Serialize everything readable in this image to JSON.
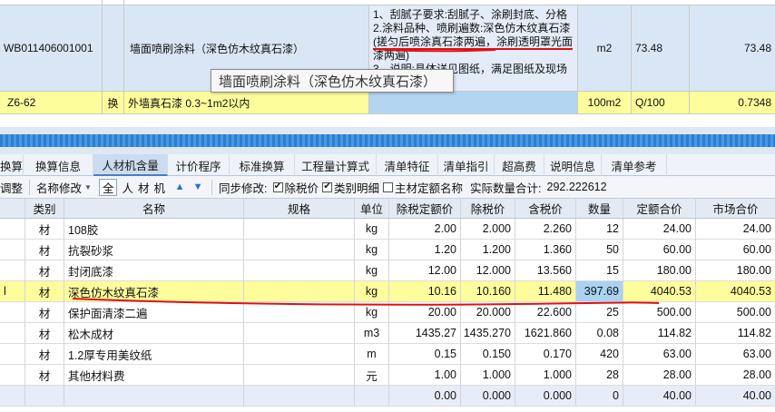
{
  "quota_grid": {
    "main_row": {
      "code": "WB011406001001",
      "name": "墙面喷刷涂料（深色仿木纹真石漆）",
      "features": [
        "1、刮腻子要求:刮腻子、涂刷封底、分格",
        "2.涂料品种、喷刷遍数:深色仿木纹真石漆",
        "(搓匀后喷涂真石漆两遍，涂刷透明罩光面",
        "漆两遍)",
        "3、说明:具体详见图纸，满足图纸及现场"
      ],
      "unit": "m2",
      "quantity": "73.48",
      "total_quantity": "73.48"
    },
    "sub_row": {
      "code": "Z6-62",
      "flag": "换",
      "name": "外墙真石漆 0.3~1m2以内",
      "unit": "100m2",
      "expression": "Q/100",
      "quantity": "0.7348"
    },
    "tooltip": "墙面喷刷涂料（深色仿木纹真石漆）"
  },
  "tabs": [
    {
      "label": "标准换算"
    },
    {
      "label": "换算信息"
    },
    {
      "label": "人材机含量"
    },
    {
      "label": "计价程序"
    },
    {
      "label": "标准换算"
    },
    {
      "label": "工程量计算式"
    },
    {
      "label": "清单特征"
    },
    {
      "label": "清单指引"
    },
    {
      "label": "超高费"
    },
    {
      "label": "说明信息"
    },
    {
      "label": "清单参考"
    }
  ],
  "toolbar": {
    "adjust": "调整",
    "rename": "名称修改",
    "filters": [
      "全",
      "人",
      "材",
      "机"
    ],
    "sync_label": "同步修改:",
    "excl_tax": "除税价",
    "category_detail": "类别明细",
    "main_quota_name": "主材定额名称",
    "actual_total_label": "实际数量合计:",
    "actual_total_value": "292.222612",
    "excl_tax_checked": "✔",
    "category_detail_checked": "✔",
    "main_quota_checked": ""
  },
  "materials": {
    "headers": [
      "",
      "类别",
      "名称",
      "规格",
      "单位",
      "除税定额价",
      "除税价",
      "含税价",
      "数量",
      "定额合价",
      "市场合价"
    ],
    "rows": [
      {
        "marker": "",
        "cat": "材",
        "name": "108胶",
        "spec": "",
        "unit": "kg",
        "quota_price": "2.00",
        "excl_price": "2.000",
        "incl_price": "2.260",
        "qty": "12",
        "quota_total": "24.00",
        "market_total": "24.00"
      },
      {
        "marker": "",
        "cat": "材",
        "name": "抗裂砂浆",
        "spec": "",
        "unit": "kg",
        "quota_price": "1.20",
        "excl_price": "1.200",
        "incl_price": "1.360",
        "qty": "50",
        "quota_total": "60.00",
        "market_total": "60.00"
      },
      {
        "marker": "",
        "cat": "材",
        "name": "封闭底漆",
        "spec": "",
        "unit": "kg",
        "quota_price": "12.00",
        "excl_price": "12.000",
        "incl_price": "13.560",
        "qty": "15",
        "quota_total": "180.00",
        "market_total": "180.00"
      },
      {
        "marker": "l",
        "cat": "材",
        "name": "深色仿木纹真石漆",
        "spec": "",
        "unit": "kg",
        "quota_price": "10.16",
        "excl_price": "10.160",
        "incl_price": "11.480",
        "qty": "397.69",
        "quota_total": "4040.53",
        "market_total": "4040.53"
      },
      {
        "marker": "",
        "cat": "材",
        "name": "保护面清漆二遍",
        "spec": "",
        "unit": "kg",
        "quota_price": "20.00",
        "excl_price": "20.000",
        "incl_price": "22.600",
        "qty": "25",
        "quota_total": "500.00",
        "market_total": "500.00"
      },
      {
        "marker": "",
        "cat": "材",
        "name": "松木成材",
        "spec": "",
        "unit": "m3",
        "quota_price": "1435.27",
        "excl_price": "1435.270",
        "incl_price": "1621.860",
        "qty": "0.08",
        "quota_total": "114.82",
        "market_total": "114.82"
      },
      {
        "marker": "",
        "cat": "材",
        "name": "1.2厚专用美纹纸",
        "spec": "",
        "unit": "m",
        "quota_price": "0.15",
        "excl_price": "0.150",
        "incl_price": "0.170",
        "qty": "420",
        "quota_total": "63.00",
        "market_total": "63.00"
      },
      {
        "marker": "",
        "cat": "材",
        "name": "其他材料费",
        "spec": "",
        "unit": "元",
        "quota_price": "1.00",
        "excl_price": "1.000",
        "incl_price": "1.000",
        "qty": "28",
        "quota_total": "28.00",
        "market_total": "28.00"
      },
      {
        "marker": "",
        "cat": "",
        "name": "",
        "spec": "",
        "unit": "",
        "quota_price": "0.00",
        "excl_price": "0.000",
        "incl_price": "0.000",
        "qty": "0",
        "quota_total": "40.00",
        "market_total": "40.00"
      }
    ]
  },
  "colors": {
    "highlight_row": "#fdfd9c",
    "selected_cell": "#a9d2f3",
    "annotation_line": "#e01010",
    "splitter": "#2b7fd0"
  }
}
